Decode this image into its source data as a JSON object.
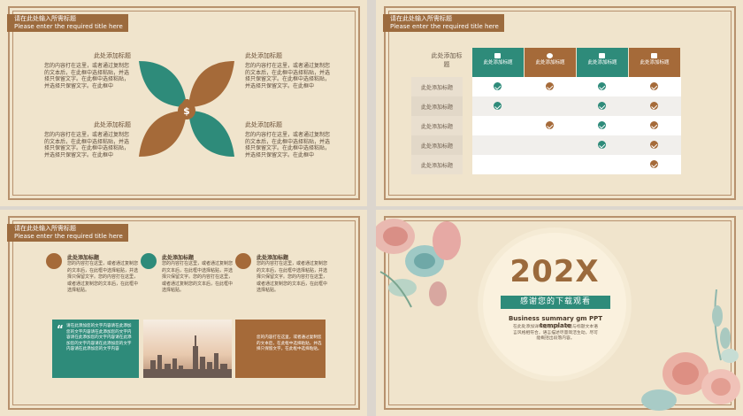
{
  "header": {
    "zh": "请在此处输入所需标题",
    "en": "Please enter the required title here"
  },
  "slide1": {
    "blocks": [
      {
        "title": "此处添加标题",
        "body": "您的内容打在这里，或者通过复制您的文本后，在此框中选择粘贴，并选择只保留文字。在此框中选择粘贴，并选择只保留文字。在此框中"
      },
      {
        "title": "此处添加标题",
        "body": "您的内容打在这里，或者通过复制您的文本后，在此框中选择粘贴，并选择只保留文字。在此框中选择粘贴，并选择只保留文字。在此框中"
      },
      {
        "title": "此处添加标题",
        "body": "您的内容打在这里，或者通过复制您的文本后，在此框中选择粘贴，并选择只保留文字。在此框中选择粘贴，并选择只保留文字。在此框中"
      },
      {
        "title": "此处添加标题",
        "body": "您的内容打在这里，或者通过复制您的文本后，在此框中选择粘贴，并选择只保留文字。在此框中选择粘贴，并选择只保留文字。在此框中"
      }
    ],
    "center_icon": "money-bag-icon"
  },
  "slide2": {
    "corner_label": "此处添加标题",
    "columns": [
      {
        "label": "此处添加标题",
        "color": "#2e8b7a",
        "icon": "trophy-icon"
      },
      {
        "label": "此处添加标题",
        "color": "#a56a39",
        "icon": "chat-icon"
      },
      {
        "label": "此处添加标题",
        "color": "#2e8b7a",
        "icon": "briefcase-icon"
      },
      {
        "label": "此处添加标题",
        "color": "#a56a39",
        "icon": "folder-icon"
      }
    ],
    "rows": [
      {
        "label": "此处添加标题",
        "checks": [
          true,
          true,
          true,
          true
        ]
      },
      {
        "label": "此处添加标题",
        "checks": [
          true,
          false,
          true,
          true
        ]
      },
      {
        "label": "此处添加标题",
        "checks": [
          false,
          true,
          true,
          true
        ]
      },
      {
        "label": "此处添加标题",
        "checks": [
          false,
          false,
          true,
          true
        ]
      },
      {
        "label": "此处添加标题",
        "checks": [
          false,
          false,
          false,
          true
        ]
      }
    ]
  },
  "slide3": {
    "items": [
      {
        "title": "此处添加标题",
        "body": "您的内容打在这里，或者通过复制您的文本后，在此框中选择粘贴，并选择只保留文字。您的内容打在这里，或者通过复制您的文本后，在此框中选择粘贴。",
        "icon": "briefcase-icon"
      },
      {
        "title": "此处添加标题",
        "body": "您的内容打在这里，或者通过复制您的文本后，在此框中选择粘贴，并选择只保留文字。您的内容打在这里，或者通过复制您的文本后，在此框中选择粘贴。",
        "icon": "globe-icon"
      },
      {
        "title": "此处添加标题",
        "body": "您的内容打在这里，或者通过复制您的文本后，在此框中选择粘贴，并选择只保留文字。您的内容打在这里，或者通过复制您的文本后，在此框中选择粘贴。",
        "icon": "chat-icon"
      }
    ],
    "quote": "请在此添加您的文字内容请在此添加您的文字内容请在此添加您的文字内容请在此添加您的文字内容请在此添加您的文字内容请在此添加您的文字内容请在此添加您的文字内容",
    "box_text": "您的内容打在这里，或者通过复制您的文本后，在此框中选择粘贴，并选择只保留文字。在此框中选择粘贴。"
  },
  "slide4": {
    "year": "202X",
    "thanks": "感谢您的下载观看",
    "subtitle": "Business summary gm PPT template",
    "body": "在此处添加详细描述文本，尽量与标题文本语言风格相符合，语言描述尽量简洁生动，尽可能概括出段落内容。"
  }
}
